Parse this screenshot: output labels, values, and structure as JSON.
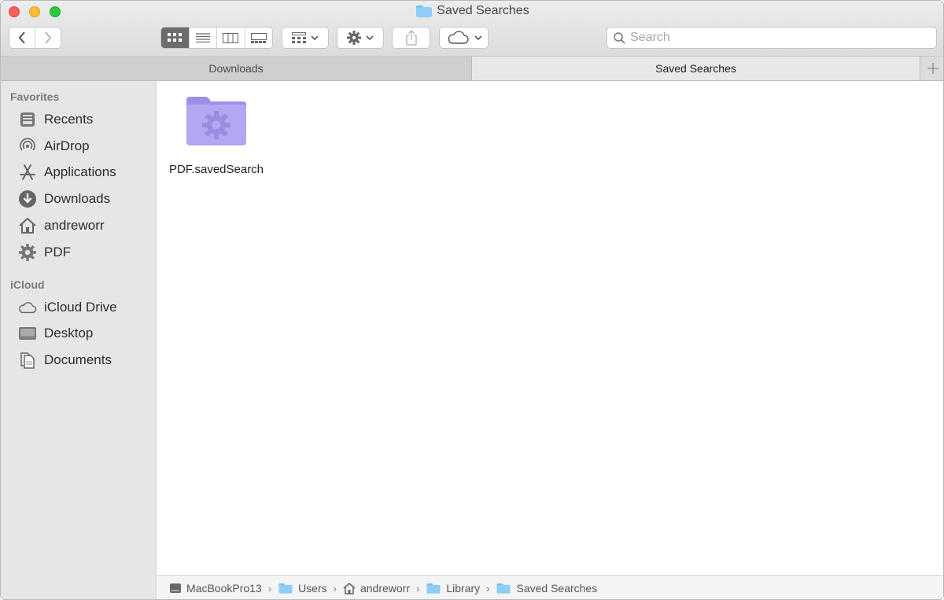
{
  "window": {
    "title": "Saved Searches"
  },
  "toolbar": {
    "back": "back",
    "forward": "forward",
    "search_placeholder": "Search"
  },
  "tabs": [
    {
      "label": "Downloads",
      "active": false
    },
    {
      "label": "Saved Searches",
      "active": true
    }
  ],
  "sidebar": {
    "favorites_header": "Favorites",
    "favorites": [
      {
        "label": "Recents",
        "icon": "recents-icon"
      },
      {
        "label": "AirDrop",
        "icon": "airdrop-icon"
      },
      {
        "label": "Applications",
        "icon": "applications-icon"
      },
      {
        "label": "Downloads",
        "icon": "downloads-icon"
      },
      {
        "label": "andreworr",
        "icon": "home-icon"
      },
      {
        "label": "PDF",
        "icon": "gear-icon"
      }
    ],
    "icloud_header": "iCloud",
    "icloud": [
      {
        "label": "iCloud Drive",
        "icon": "cloud-icon"
      },
      {
        "label": "Desktop",
        "icon": "desktop-icon"
      },
      {
        "label": "Documents",
        "icon": "documents-icon"
      }
    ]
  },
  "files": [
    {
      "name": "PDF.savedSearch",
      "icon": "smart-folder-icon"
    }
  ],
  "pathbar": [
    {
      "label": "MacBookPro13",
      "icon": "hard-drive-icon"
    },
    {
      "label": "Users",
      "icon": "folder-icon"
    },
    {
      "label": "andreworr",
      "icon": "home-icon"
    },
    {
      "label": "Library",
      "icon": "folder-icon"
    },
    {
      "label": "Saved Searches",
      "icon": "folder-icon"
    }
  ],
  "colors": {
    "smart_folder": "#b3a6f2",
    "folder_blue": "#8fcdf6",
    "sidebar_bg": "#e6e6e6"
  }
}
